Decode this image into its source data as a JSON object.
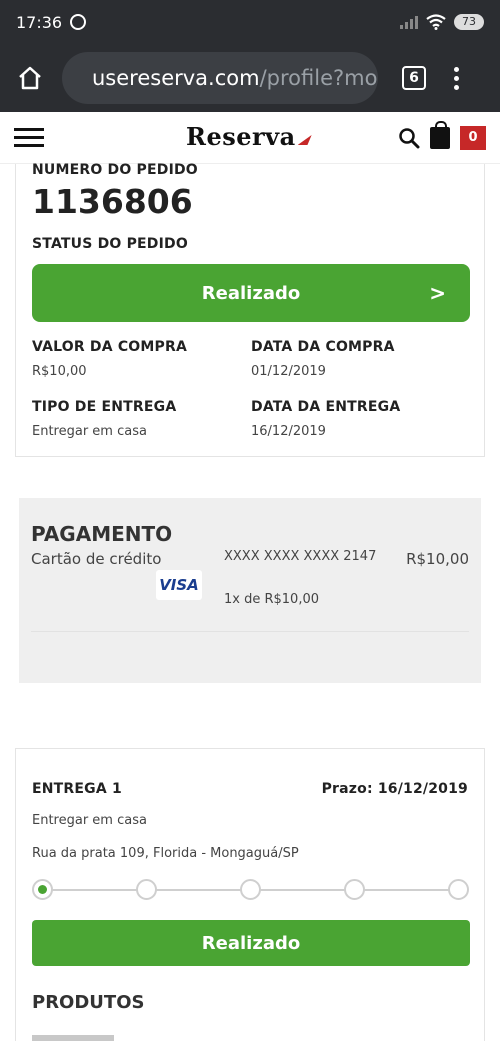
{
  "status_bar": {
    "time": "17:36",
    "battery": "73"
  },
  "browser": {
    "url_host": "usereserva.com",
    "url_path": "/profile?mo",
    "tab_count": "6"
  },
  "site": {
    "logo": "Reserva",
    "cart_count": "0"
  },
  "order": {
    "number_label": "NUMERO DO PEDIDO",
    "number": "1136806",
    "status_label": "STATUS DO PEDIDO",
    "status": "Realizado",
    "status_arrow": ">",
    "purchase_value_label": "VALOR DA COMPRA",
    "purchase_value": "R$10,00",
    "purchase_date_label": "DATA DA COMPRA",
    "purchase_date": "01/12/2019",
    "delivery_type_label": "TIPO DE ENTREGA",
    "delivery_type": "Entregar em casa",
    "delivery_date_label": "DATA DA ENTREGA",
    "delivery_date": "16/12/2019"
  },
  "payment": {
    "title": "PAGAMENTO",
    "method": "Cartão de crédito",
    "card_number": "XXXX XXXX XXXX 2147",
    "amount": "R$10,00",
    "card_brand": "VISA",
    "installments": "1x de R$10,00"
  },
  "delivery": {
    "title": "ENTREGA 1",
    "deadline": "Prazo: 16/12/2019",
    "type": "Entregar em casa",
    "address": "Rua da prata 109, Florida - Mongaguá/SP",
    "progress": {
      "steps": 5,
      "current": 1
    },
    "status": "Realizado",
    "products_title": "PRODUTOS"
  },
  "colors": {
    "accent_green": "#4aa433",
    "brand_red": "#c62828",
    "chrome_dark": "#2b2d31"
  }
}
